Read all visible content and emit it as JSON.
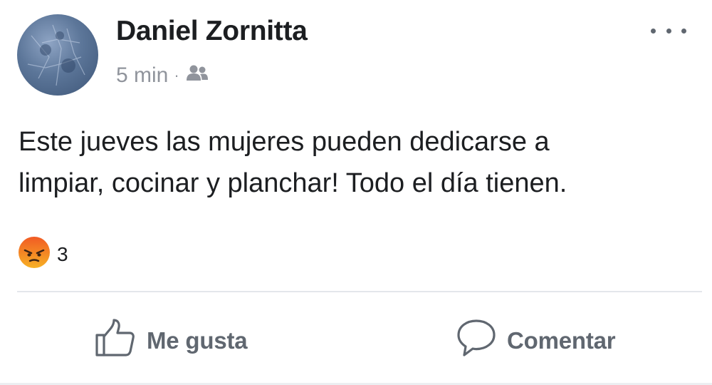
{
  "post": {
    "author": {
      "name": "Daniel Zornitta",
      "avatar_icon": "profile-photo"
    },
    "meta": {
      "time": "5 min",
      "separator": "·",
      "audience_icon": "friends-audience-icon"
    },
    "text_lines": [
      "Este jueves las mujeres pueden dedicarse a",
      "limpiar, cocinar y planchar! Todo el día tienen."
    ],
    "reactions": {
      "icon": "angry-reaction-icon",
      "count": "3"
    },
    "actions": {
      "like": {
        "label": "Me gusta",
        "icon": "thumbs-up-icon"
      },
      "comment": {
        "label": "Comentar",
        "icon": "speech-bubble-icon"
      }
    },
    "colors": {
      "name": "#1c1e21",
      "meta": "#90949c",
      "action": "#606770",
      "angry_top": "#f15a24",
      "angry_bottom": "#f7b125"
    }
  }
}
